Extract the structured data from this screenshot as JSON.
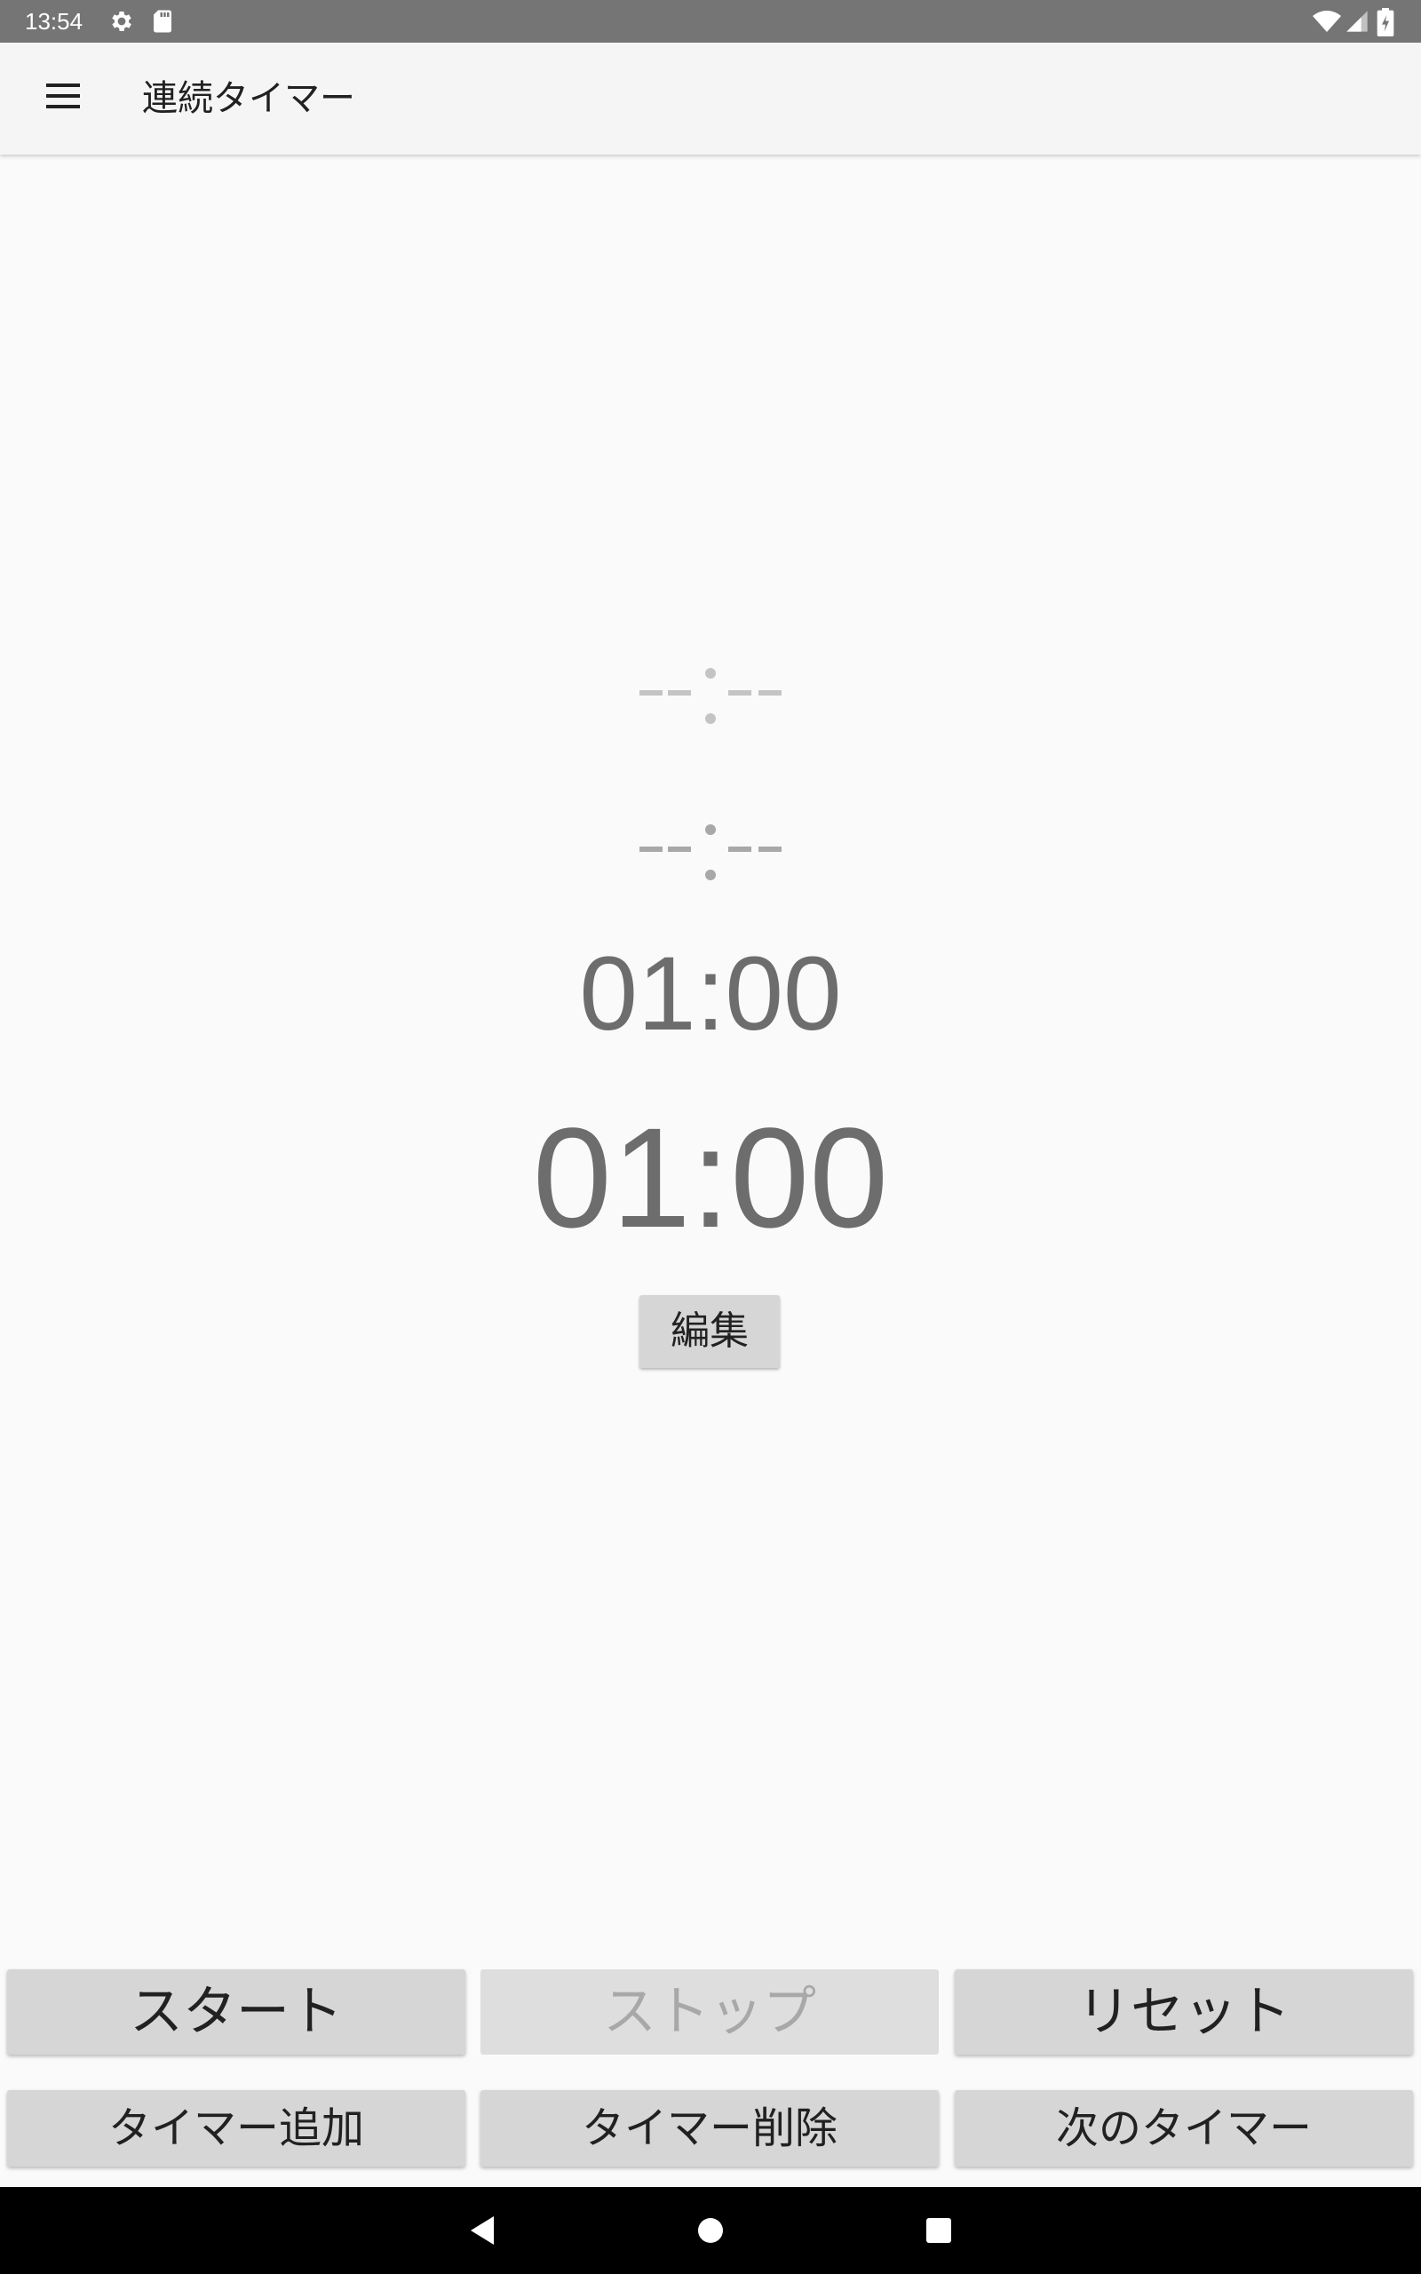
{
  "status_bar": {
    "time": "13:54",
    "icons": [
      "gear-icon",
      "sd-card-icon",
      "wifi-icon",
      "signal-icon",
      "battery-charging-icon"
    ]
  },
  "app_bar": {
    "menu_icon": "hamburger-menu-icon",
    "title": "連続タイマー"
  },
  "timers": {
    "previous_placeholder": "--:--",
    "previous_placeholder_2": "--:--",
    "next_time": "01:00",
    "current_time": "01:00",
    "edit_label": "編集"
  },
  "controls": {
    "start_label": "スタート",
    "stop_label": "ストップ",
    "reset_label": "リセット",
    "add_timer_label": "タイマー追加",
    "delete_timer_label": "タイマー削除",
    "next_timer_label": "次のタイマー",
    "stop_enabled": false
  },
  "nav_bar": {
    "icons": [
      "back-icon",
      "home-icon",
      "recents-icon"
    ]
  },
  "colors": {
    "status_bar": "#757575",
    "app_bar": "#f5f5f5",
    "background": "#fafafa",
    "button": "#d6d6d6",
    "timer_text": "#6d6d6d",
    "placeholder_light": "#c4c4c4",
    "placeholder_dark": "#a8a8a8"
  }
}
